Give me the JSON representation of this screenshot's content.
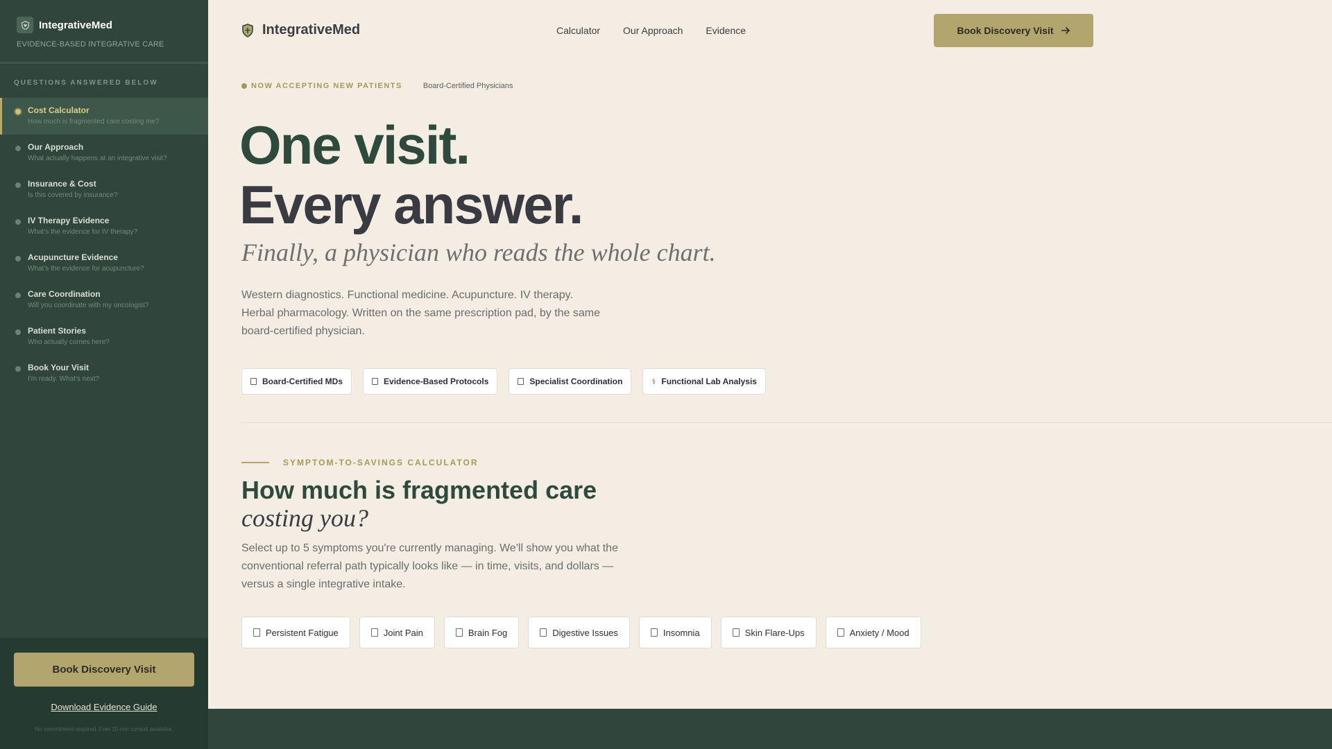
{
  "colors": {
    "sidebar_bg": "#30463c",
    "accent_gold": "#b3a56e",
    "heading_green": "#2f4a3d",
    "page_bg": "#f3ede3"
  },
  "sidebar": {
    "brand": "IntegrativeMed",
    "tagline": "EVIDENCE-BASED INTEGRATIVE CARE",
    "logo_icon": "shield-heart-icon",
    "section_label": "QUESTIONS ANSWERED BELOW",
    "items": [
      {
        "title": "Cost Calculator",
        "subtitle": "How much is fragmented care costing me?",
        "active": true
      },
      {
        "title": "Our Approach",
        "subtitle": "What actually happens at an integrative visit?"
      },
      {
        "title": "Insurance & Cost",
        "subtitle": "Is this covered by insurance?"
      },
      {
        "title": "IV Therapy Evidence",
        "subtitle": "What's the evidence for IV therapy?"
      },
      {
        "title": "Acupuncture Evidence",
        "subtitle": "What's the evidence for acupuncture?"
      },
      {
        "title": "Care Coordination",
        "subtitle": "Will you coordinate with my oncologist?"
      },
      {
        "title": "Patient Stories",
        "subtitle": "Who actually comes here?"
      },
      {
        "title": "Book Your Visit",
        "subtitle": "I'm ready. What's next?"
      }
    ],
    "cta_label": "Book Discovery Visit",
    "download_label": "Download Evidence Guide",
    "fine_print": "No commitment required. Free 15-min consult available."
  },
  "topnav": {
    "brand": "IntegrativeMed",
    "logo_icon": "shield-icon",
    "links": [
      "Calculator",
      "Our Approach",
      "Evidence"
    ],
    "cta_label": "Book Discovery Visit",
    "cta_icon": "arrow-right-icon"
  },
  "hero": {
    "badge_accepting": "NOW ACCEPTING NEW PATIENTS",
    "badge_board": "Board-Certified Physicians",
    "headline_line1": "One visit.",
    "headline_line2": "Every answer.",
    "subheadline": "Finally, a physician who reads the whole chart.",
    "intro": "Western diagnostics. Functional medicine. Acupuncture. IV therapy. Herbal pharmacology. Written on the same prescription pad, by the same board-certified physician.",
    "trust_chips": [
      {
        "label": "Board-Certified MDs",
        "icon": "box-icon"
      },
      {
        "label": "Evidence-Based Protocols",
        "icon": "box-icon"
      },
      {
        "label": "Specialist Coordination",
        "icon": "box-icon"
      },
      {
        "label": "Functional Lab Analysis",
        "icon": "caduceus-icon"
      }
    ]
  },
  "calculator": {
    "eyebrow": "SYMPTOM-TO-SAVINGS CALCULATOR",
    "title": "How much is fragmented care",
    "title_italic": "costing you?",
    "description": "Select up to 5 symptoms you're currently managing. We'll show you what the conventional referral path typically looks like — in time, visits, and dollars — versus a single integrative intake.",
    "symptoms": [
      "Persistent Fatigue",
      "Joint Pain",
      "Brain Fog",
      "Digestive Issues",
      "Insomnia",
      "Skin Flare-Ups",
      "Anxiety / Mood"
    ]
  }
}
